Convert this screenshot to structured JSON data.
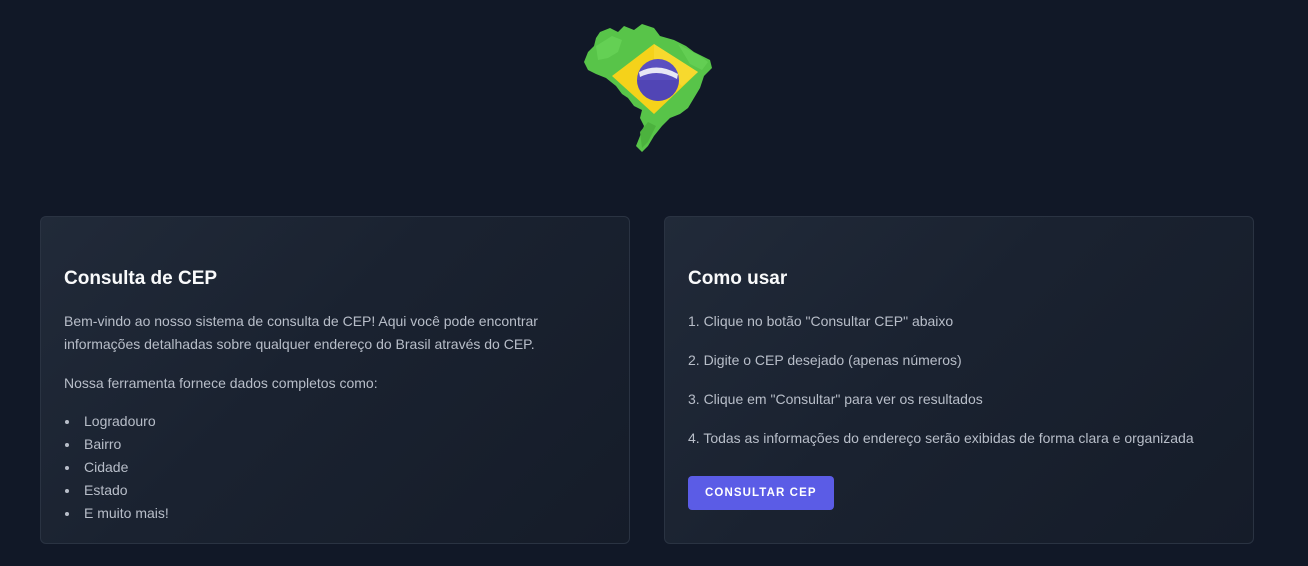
{
  "logo": {
    "icon": "brazil-map-flag-icon"
  },
  "info_card": {
    "title": "Consulta de CEP",
    "intro": "Bem-vindo ao nosso sistema de consulta de CEP! Aqui você pode encontrar informações detalhadas sobre qualquer endereço do Brasil através do CEP.",
    "features_intro": "Nossa ferramenta fornece dados completos como:",
    "features": [
      "Logradouro",
      "Bairro",
      "Cidade",
      "Estado",
      "E muito mais!"
    ]
  },
  "howto_card": {
    "title": "Como usar",
    "steps": [
      "1. Clique no botão \"Consultar CEP\" abaixo",
      "2. Digite o CEP desejado (apenas números)",
      "3. Clique em \"Consultar\" para ver os resultados",
      "4. Todas as informações do endereço serão exibidas de forma clara e organizada"
    ],
    "button_label": "CONSULTAR CEP"
  },
  "colors": {
    "background": "#111827",
    "card": "#1b2331",
    "accent": "#5b5ce6",
    "flag_green": "#58c449",
    "flag_yellow": "#f5d21a",
    "flag_blue": "#5a4fc0"
  }
}
